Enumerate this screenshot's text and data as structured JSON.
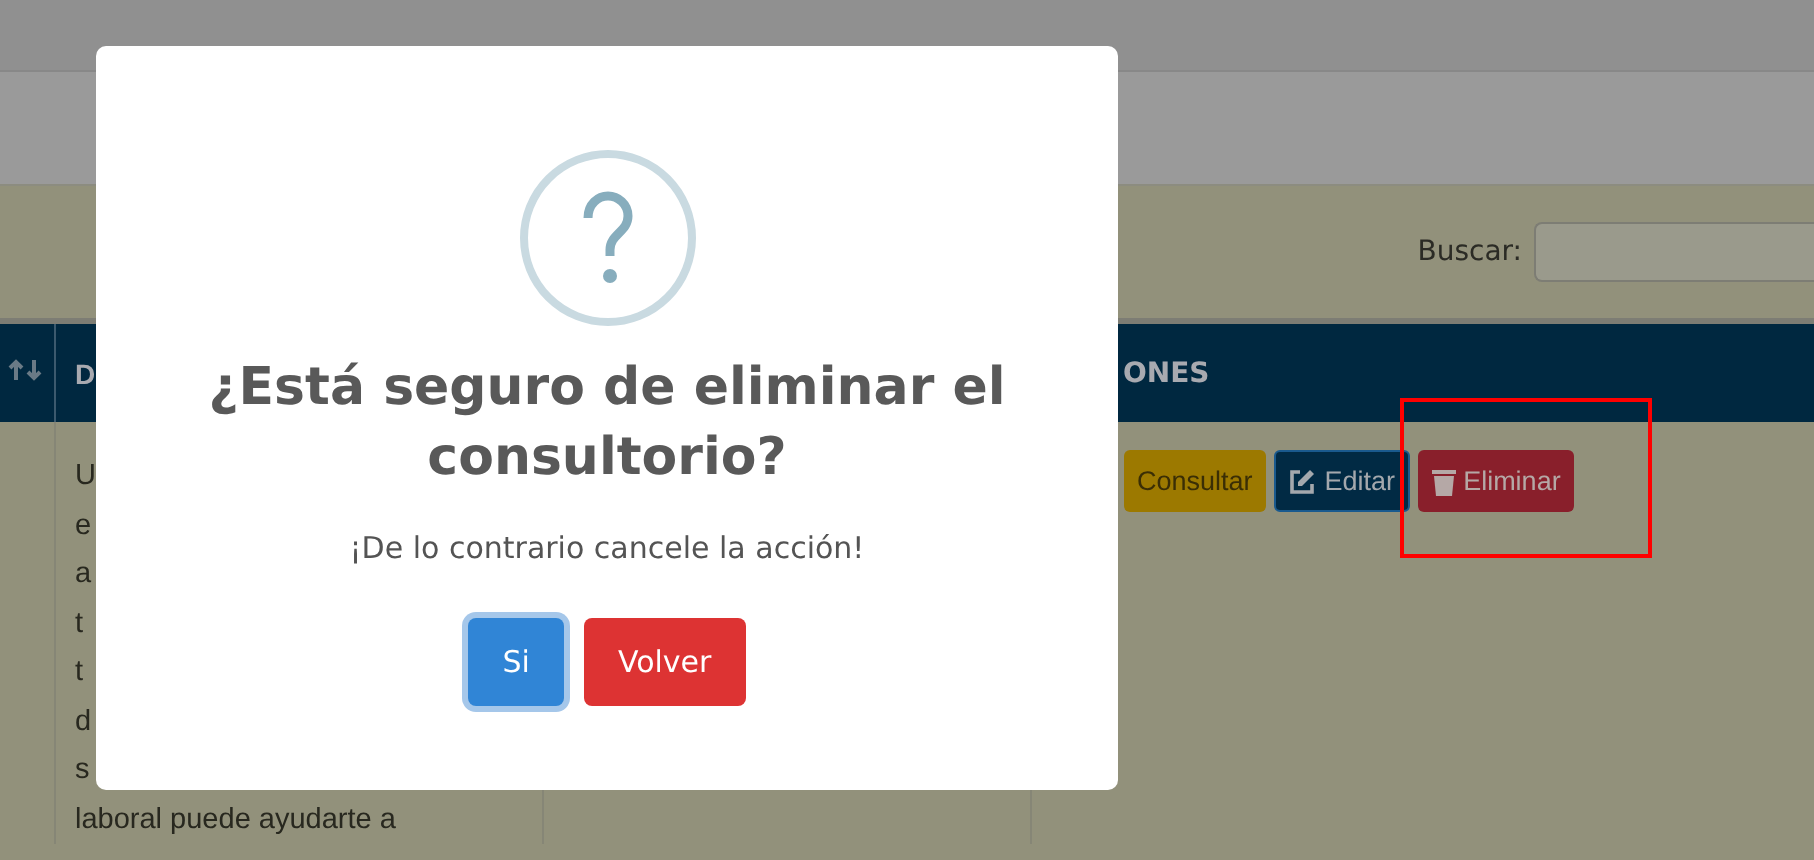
{
  "toolbar": {
    "search_label": "Buscar:"
  },
  "table": {
    "columns": [
      {
        "kind": "sort"
      },
      {
        "kind": "text",
        "label": "D"
      },
      {
        "kind": "blank"
      },
      {
        "kind": "text",
        "label": "ONES"
      }
    ],
    "rows": [
      {
        "description": [
          "U",
          "e",
          "a",
          "t",
          "t",
          "d",
          "s",
          "laboral puede ayudarte a"
        ],
        "actions": [
          {
            "label": "Consultar",
            "kind": "consult"
          },
          {
            "label": "Editar",
            "kind": "edit"
          },
          {
            "label": "Eliminar",
            "kind": "delete"
          }
        ]
      }
    ]
  },
  "modal": {
    "title": "¿Está seguro de eliminar el consultorio?",
    "text": "¡De lo contrario cancele la acción!",
    "buttons": [
      {
        "label": "Si",
        "kind": "confirm",
        "focused": true
      },
      {
        "label": "Volver",
        "kind": "cancel",
        "focused": false
      }
    ]
  }
}
